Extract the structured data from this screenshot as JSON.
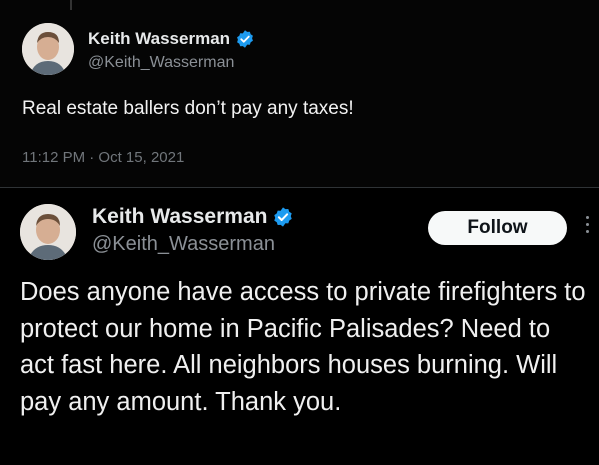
{
  "quoted_tweet": {
    "author_name": "Keith Wasserman",
    "handle": "@Keith_Wasserman",
    "text": "Real estate ballers don’t pay any taxes!",
    "timestamp": "11:12 PM · Oct 15, 2021",
    "verified_icon": "verified-badge-icon"
  },
  "main_tweet": {
    "author_name": "Keith Wasserman",
    "handle": "@Keith_Wasserman",
    "follow_label": "Follow",
    "text": "Does anyone have access to private firefighters to protect our home in Pacific Palisades? Need to act fast here. All neighbors houses burning. Will pay any amount. Thank you.",
    "verified_icon": "verified-badge-icon"
  },
  "colors": {
    "background": "#000000",
    "verified_blue": "#1d9bf0",
    "secondary_text": "#71767b"
  }
}
